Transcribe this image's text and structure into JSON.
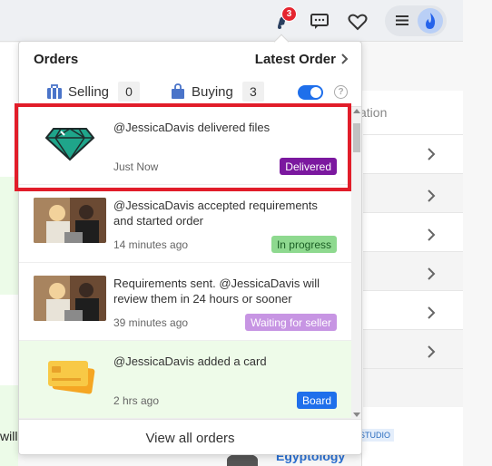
{
  "topbar": {
    "notification_count": "3",
    "icons": [
      "bell-icon",
      "chat-icon",
      "heart-icon",
      "hamburger-icon",
      "flame-avatar-icon"
    ]
  },
  "background": {
    "left_text": "will",
    "right_header": "ation",
    "chip": "STUDIO",
    "link": "Egyptology"
  },
  "dropdown": {
    "title": "Orders",
    "latest_order_label": "Latest Order",
    "tabs": [
      {
        "label": "Selling",
        "count": "0"
      },
      {
        "label": "Buying",
        "count": "3"
      }
    ],
    "items": [
      {
        "message": "@JessicaDavis delivered files",
        "time": "Just Now",
        "status": "Delivered",
        "thumb": "diamond-icon"
      },
      {
        "message": "@JessicaDavis accepted requirements and started order",
        "time": "14 minutes ago",
        "status": "In progress",
        "thumb": "people-photo"
      },
      {
        "message": "Requirements sent. @JessicaDavis will review them in 24 hours or sooner",
        "time": "39 minutes ago",
        "status": "Waiting for seller",
        "thumb": "people-photo"
      },
      {
        "message": "@JessicaDavis added a card",
        "time": "2 hrs ago",
        "status": "Board",
        "thumb": "card-icon"
      }
    ],
    "view_all_label": "View all orders"
  },
  "colors": {
    "delivered": "#7b189f",
    "in_progress": "#8ed98f",
    "waiting": "#c795e3",
    "board": "#1f6feb",
    "highlight": "#e11d2a",
    "accent": "#4a74c9"
  }
}
